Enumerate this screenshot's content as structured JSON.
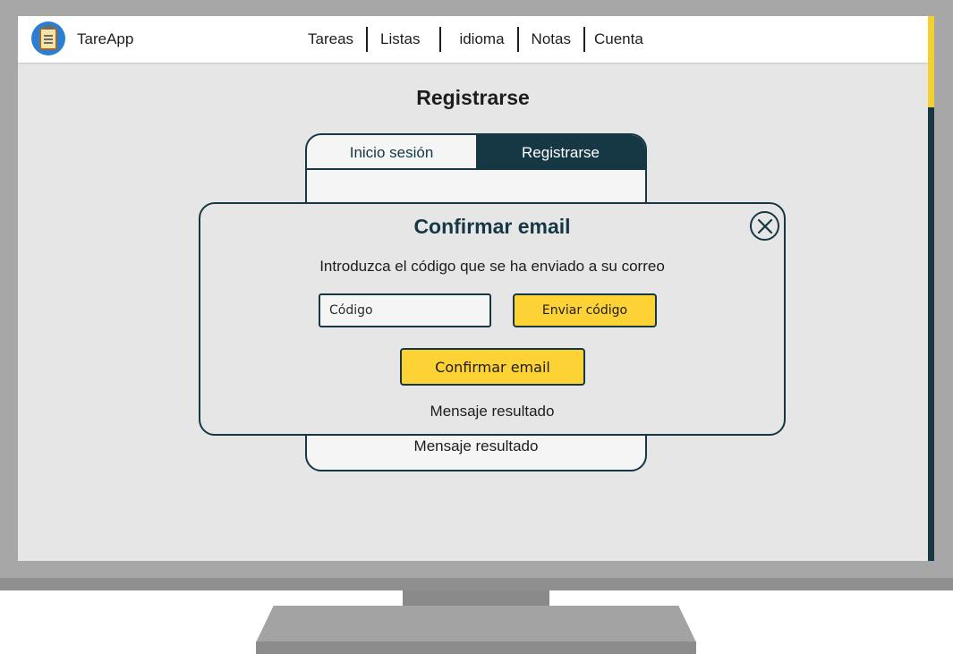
{
  "app": {
    "name": "TareApp",
    "logo_icon": "clipboard-icon"
  },
  "nav": {
    "items": [
      "Tareas",
      "Listas",
      "idioma",
      "Notas",
      "Cuenta"
    ]
  },
  "page": {
    "title": "Registrarse"
  },
  "auth_card": {
    "tabs": [
      {
        "label": "Inicio sesión",
        "active": false
      },
      {
        "label": "Registrarse",
        "active": true
      }
    ],
    "result_message": "Mensaje resultado"
  },
  "modal": {
    "title": "Confirmar email",
    "description": "Introduzca el código que se ha enviado a su correo",
    "code_field": {
      "value": "",
      "placeholder": "Código"
    },
    "send_code_label": "Enviar código",
    "confirm_label": "Confirmar email",
    "result_message": "Mensaje resultado",
    "close_icon": "close-icon"
  },
  "colors": {
    "primary_dark": "#163844",
    "accent_yellow": "#fdd235",
    "screen_background": "#e6e6e6",
    "card_background": "#f5f5f5"
  }
}
